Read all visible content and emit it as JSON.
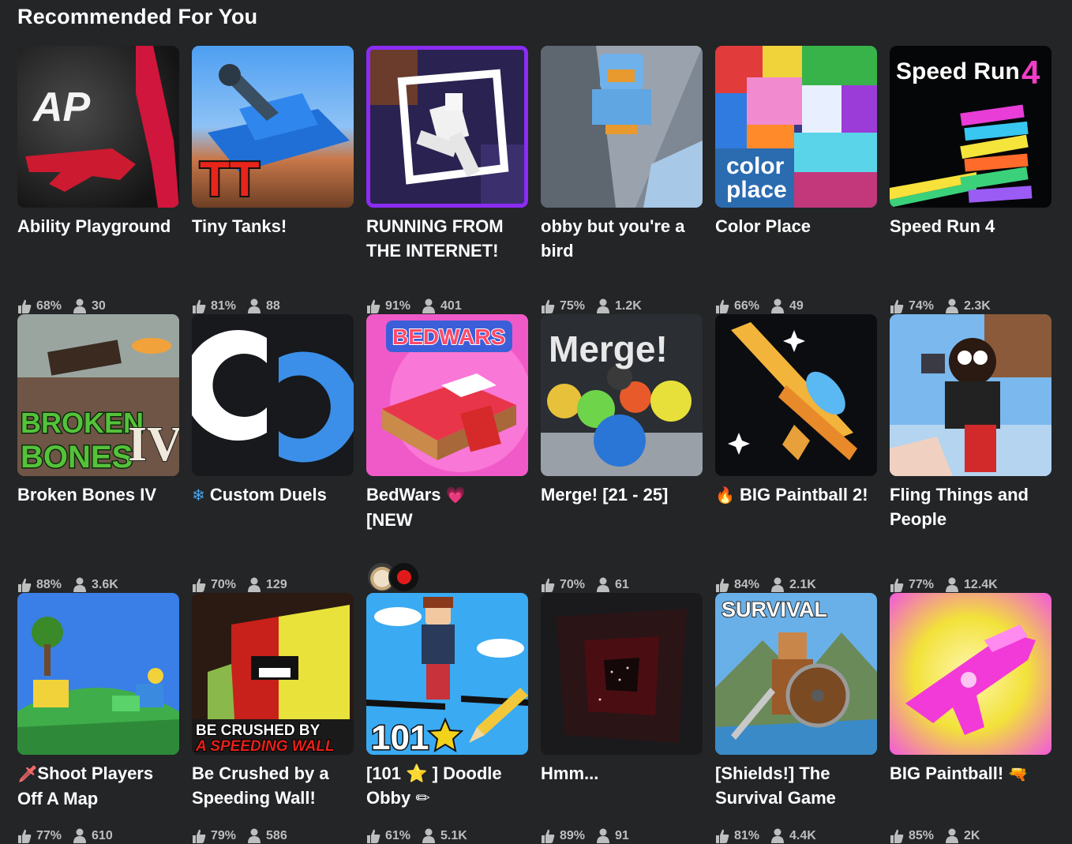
{
  "section": {
    "title": "Recommended For You"
  },
  "games": [
    {
      "name": "Ability Playground",
      "rating": "68%",
      "players": "30"
    },
    {
      "name": "Tiny Tanks!",
      "rating": "81%",
      "players": "88"
    },
    {
      "name": "RUNNING FROM THE INTERNET!",
      "rating": "91%",
      "players": "401"
    },
    {
      "name": "obby but you're a bird",
      "rating": "75%",
      "players": "1.2K"
    },
    {
      "name": "Color Place",
      "rating": "66%",
      "players": "49"
    },
    {
      "name": "Speed Run 4",
      "rating": "74%",
      "players": "2.3K"
    },
    {
      "name": "Broken Bones IV",
      "rating": "88%",
      "players": "3.6K"
    },
    {
      "name_prefix": "❄",
      "name": "Custom Duels",
      "rating": "70%",
      "players": "129"
    },
    {
      "name": "BedWars",
      "name_suffix": "💗",
      "name_line2": "[NEW"
    },
    {
      "name": "Merge! [21 - 25]",
      "rating": "70%",
      "players": "61"
    },
    {
      "name_prefix": "🔥",
      "name": "BIG Paintball 2!",
      "rating": "84%",
      "players": "2.1K"
    },
    {
      "name": "Fling Things and People",
      "rating": "77%",
      "players": "12.4K"
    },
    {
      "name_prefix": "🗡",
      "name": "Shoot Players Off A Map",
      "rating": "77%",
      "players": "610"
    },
    {
      "name": "Be Crushed by a Speeding Wall!",
      "rating": "79%",
      "players": "586"
    },
    {
      "name": "[101 ⭐ ] Doodle Obby ✏",
      "rating": "61%",
      "players": "5.1K"
    },
    {
      "name": "Hmm...",
      "rating": "89%",
      "players": "91"
    },
    {
      "name": "[Shields!] The Survival Game",
      "rating": "81%",
      "players": "4.4K"
    },
    {
      "name": "BIG Paintball!",
      "name_suffix": "🔫",
      "rating": "85%",
      "players": "2K"
    }
  ],
  "thumb_text": {
    "ability": "AP",
    "tiny_tanks": "TT",
    "color_place_1": "color",
    "color_place_2": "place",
    "speed_run": "Speed Run",
    "speed_run_num": "4",
    "broken_1": "BROKEN",
    "broken_2": "BONES",
    "broken_num": "IV",
    "bedwars": "BEDWARS",
    "merge": "Merge!",
    "survival": "SURVIVAL",
    "crushed_1": "BE CRUSHED BY",
    "crushed_2": "A SPEEDING WALL",
    "doodle_num": "101"
  },
  "colors": {
    "background": "#232527",
    "text": "#ffffff",
    "stat_text": "#bdbebe",
    "selected_border": "#8b2cf5"
  },
  "icons": {
    "rating": "thumbs-up-icon",
    "players": "person-icon"
  }
}
